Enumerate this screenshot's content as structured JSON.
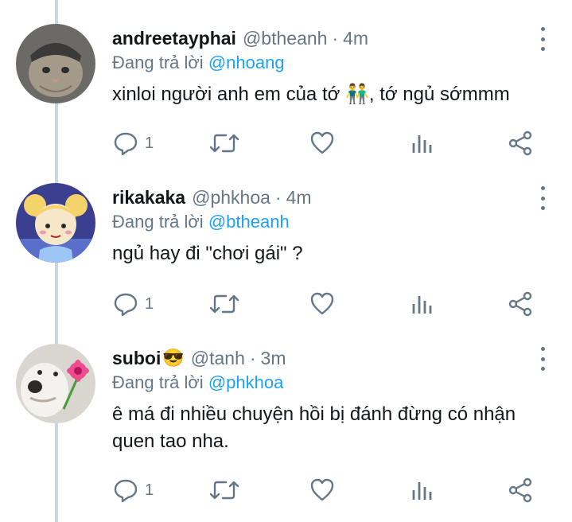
{
  "tweets": [
    {
      "name": "andreetayphai",
      "name_emoji": "",
      "handle": "@btheanh",
      "dot": "·",
      "time": "4m",
      "replying_prefix": "Đang trả lời",
      "replying_to": "@nhoang",
      "text": "xinloi người anh em của tớ 👬, tớ ngủ sớmmm",
      "reply_count": "1"
    },
    {
      "name": "rikakaka",
      "name_emoji": "",
      "handle": "@phkhoa",
      "dot": "·",
      "time": "4m",
      "replying_prefix": "Đang trả lời",
      "replying_to": "@btheanh",
      "text": "ngủ hay đi \"chơi gái\" ?",
      "reply_count": "1"
    },
    {
      "name": "suboi",
      "name_emoji": "😎",
      "handle": "@tanh",
      "dot": "·",
      "time": "3m",
      "replying_prefix": "Đang trả lời",
      "replying_to": "@phkhoa",
      "text": "ê má đi nhiều chuyện hồi bị đánh đừng có nhận quen tao nha.",
      "reply_count": "1"
    }
  ],
  "icons": {
    "reply": "reply-bubble-icon",
    "retweet": "retweet-icon",
    "like": "heart-icon",
    "analytics": "analytics-bars-icon",
    "share": "share-icon",
    "more": "more-vertical-icon"
  },
  "colors": {
    "text": "#14171a",
    "secondary": "#657786",
    "link": "#1da1f2",
    "thread_line": "#ccd6dd"
  }
}
